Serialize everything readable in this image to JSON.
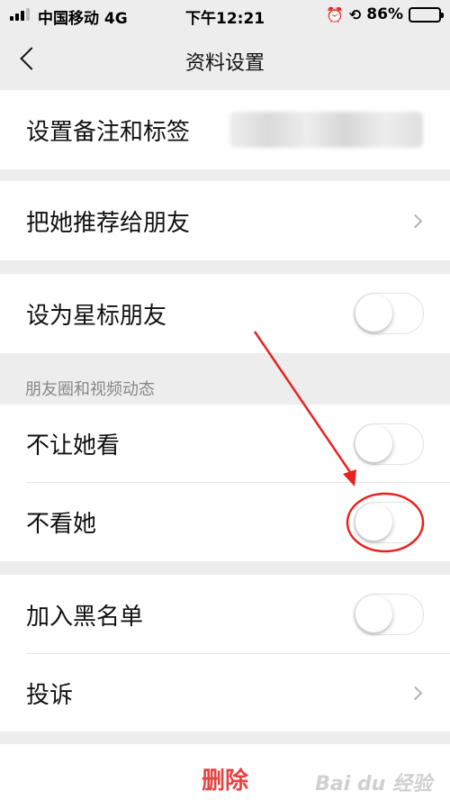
{
  "status_bar": {
    "carrier": "中国移动",
    "network": "4G",
    "time": "下午12:21",
    "battery": "86%",
    "battery_level": 0.86,
    "icons": [
      "signal-icon",
      "alarm-icon",
      "rotation-lock-icon",
      "battery-icon"
    ]
  },
  "nav": {
    "title": "资料设置",
    "back_icon": "chevron-left-icon"
  },
  "rows": {
    "remark": {
      "label": "设置备注和标签"
    },
    "recommend": {
      "label": "把她推荐给朋友"
    },
    "star": {
      "label": "设为星标朋友",
      "on": false
    },
    "moments_header": "朋友圈和视频动态",
    "hide_from_her": {
      "label": "不让她看",
      "on": false
    },
    "dont_see_her": {
      "label": "不看她",
      "on": false
    },
    "blacklist": {
      "label": "加入黑名单",
      "on": false
    },
    "complain": {
      "label": "投诉"
    }
  },
  "delete": {
    "label": "删除"
  },
  "colors": {
    "background": "#ededed",
    "delete_red": "#e64340",
    "annotation_red": "#e8231f"
  }
}
